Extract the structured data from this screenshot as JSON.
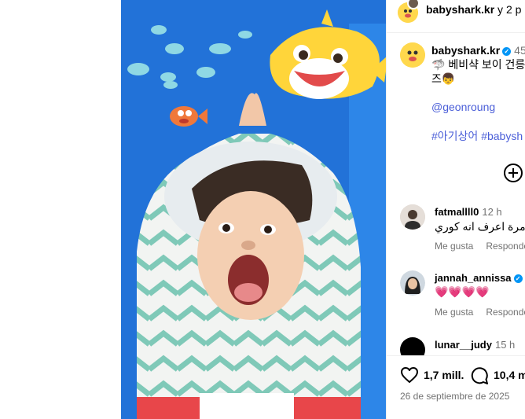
{
  "post": {
    "header": {
      "username": "babyshark.kr",
      "separator": " y 2 p"
    },
    "caption": {
      "username": "babyshark.kr",
      "verified_mark": "✓",
      "time": "45",
      "line1": "🦈 베비샥 보이 건릉",
      "line2": "즈👦",
      "mention": "@geonroung",
      "hashtags": "#아기상어 #babysh"
    },
    "comments": [
      {
        "username": "fatmallll0",
        "time": "12 h",
        "text": "ل مرة اعرف انه كوري",
        "like_label": "Me gusta",
        "reply_label": "Responder"
      },
      {
        "username": "jannah_annissa",
        "verified_mark": "✓",
        "text": "💗💗💗💗",
        "like_label": "Me gusta",
        "reply_label": "Responder"
      },
      {
        "username": "lunar__judy",
        "time": "15 h"
      }
    ],
    "footer": {
      "likes": "1,7 mill.",
      "comments": "10,4 m",
      "date": "26 de septiembre de 2025"
    }
  },
  "icons": [
    "add-comment-icon",
    "heart-icon",
    "comment-icon",
    "verified-icon"
  ],
  "colors": {
    "link": "#4a5ed8",
    "verified": "#0095f6",
    "media_background": "#1f6fd6",
    "secondary_text": "#737373"
  }
}
